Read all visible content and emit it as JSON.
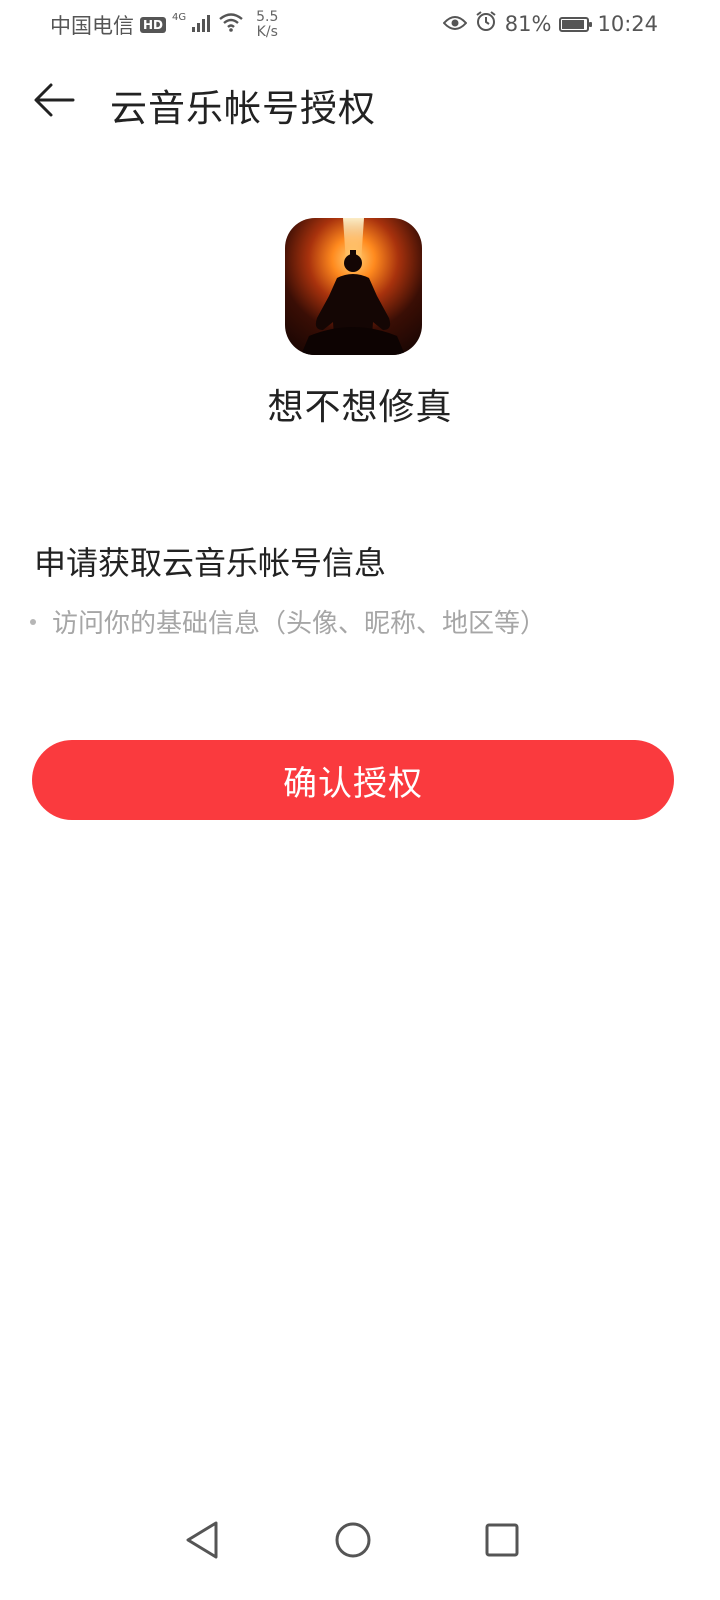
{
  "status_bar": {
    "carrier": "中国电信",
    "hd_badge": "HD",
    "network": "4G",
    "speed_value": "5.5",
    "speed_unit": "K/s",
    "battery_percent": "81%",
    "battery_level": 0.81,
    "time": "10:24",
    "icons": [
      "signal-icon",
      "wifi-icon",
      "eye-icon",
      "alarm-icon",
      "battery-icon"
    ]
  },
  "header": {
    "back_icon": "back-arrow-icon",
    "title": "云音乐帐号授权"
  },
  "app": {
    "icon": "app-icon",
    "name": "想不想修真"
  },
  "permissions": {
    "title": "申请获取云音乐帐号信息",
    "items": [
      "访问你的基础信息（头像、昵称、地区等）"
    ]
  },
  "confirm_button": {
    "label": "确认授权",
    "color": "#fa3a3e"
  },
  "nav_bar": {
    "icons": [
      "nav-back-icon",
      "nav-home-icon",
      "nav-recents-icon"
    ]
  }
}
